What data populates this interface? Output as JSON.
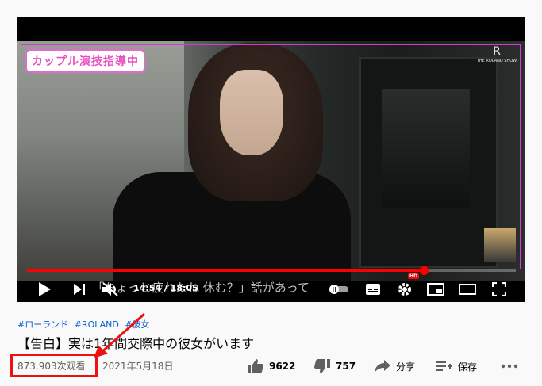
{
  "player": {
    "badge_text": "カップル演技指導中",
    "logo_letter": "R",
    "logo_text": "THE ROLAND SHOW",
    "progress_fraction": 0.8125,
    "current_time": "14:54",
    "duration": "18:05",
    "time_display": "14:54 / 18:05",
    "subtitle_text": "「ちょっと疲れたね 休む？」話があって",
    "hd_badge": "HD"
  },
  "video": {
    "hashtags": [
      "#ローランド",
      "#ROLAND",
      "#彼女"
    ],
    "title": "【告白】実は1年間交際中の彼女がいます",
    "views": "873,903次观看",
    "date": "2021年5月18日"
  },
  "actions": {
    "like_count": "9622",
    "dislike_count": "757",
    "share_label": "分享",
    "save_label": "保存"
  },
  "colors": {
    "accent_red": "#ff0000",
    "highlight_red": "#e11111",
    "link_blue": "#065fd4",
    "badge_pink": "#e84fc0"
  }
}
